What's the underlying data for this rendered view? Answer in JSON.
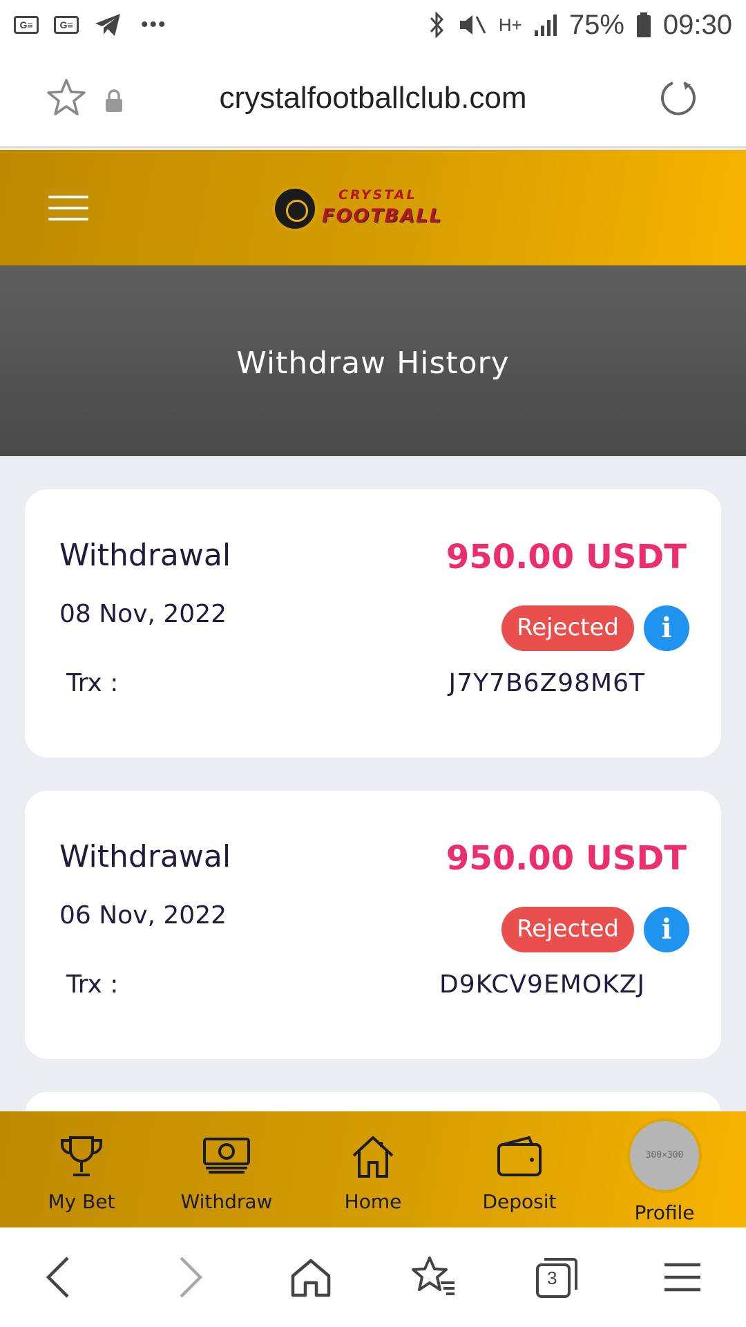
{
  "status_bar": {
    "battery": "75%",
    "time": "09:30",
    "network": "H+",
    "notif_label": "G≡"
  },
  "browser": {
    "url": "crystalfootballclub.com",
    "tab_count": "3"
  },
  "header": {
    "logo_word1": "CRYSTAL",
    "logo_word2": "FOOTBALL"
  },
  "page": {
    "title": "Withdraw History"
  },
  "withdrawals": [
    {
      "label": "Withdrawal",
      "amount": "950.00 USDT",
      "date": "08 Nov, 2022",
      "status": "Rejected",
      "trx_label": "Trx :",
      "trx_value": "J7Y7B6Z98M6T"
    },
    {
      "label": "Withdrawal",
      "amount": "950.00 USDT",
      "date": "06 Nov, 2022",
      "status": "Rejected",
      "trx_label": "Trx :",
      "trx_value": "D9KCV9EMOKZJ"
    }
  ],
  "bottom_nav": {
    "items": [
      {
        "label": "My Bet",
        "icon": "trophy-icon"
      },
      {
        "label": "Withdraw",
        "icon": "money-icon"
      },
      {
        "label": "Home",
        "icon": "home-icon"
      },
      {
        "label": "Deposit",
        "icon": "wallet-icon"
      },
      {
        "label": "Profile",
        "icon": "avatar"
      }
    ],
    "avatar_placeholder": "300×300"
  },
  "colors": {
    "header_gold": "#d69e00",
    "amount_pink": "#ec2f6c",
    "rejected_red": "#e9504d",
    "info_blue": "#1e93ef",
    "text_dark": "#231a3d"
  }
}
